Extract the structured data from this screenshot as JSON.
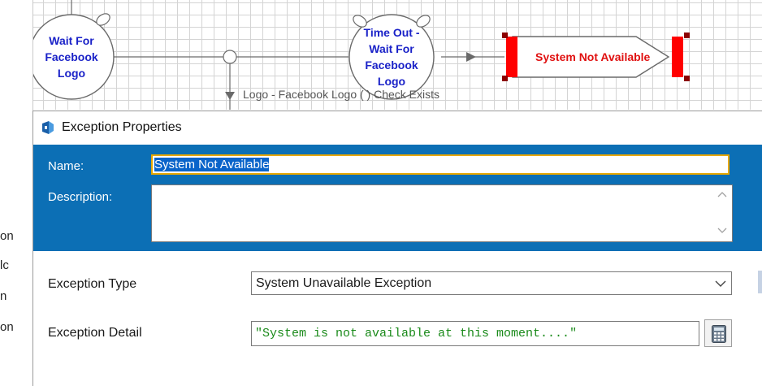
{
  "left_panel": {
    "items": [
      "on",
      "lc",
      "n",
      "on"
    ]
  },
  "flow": {
    "nodes": {
      "wait_node": "Wait For Facebook Logo",
      "timeout_node": "Time Out - Wait For Facebook Logo",
      "exception_node": "System Not Available"
    },
    "link_label": "Logo - Facebook Logo (        ) Check Exists"
  },
  "dialog": {
    "title": "Exception Properties",
    "name_label": "Name:",
    "name_value": "System Not Available",
    "description_label": "Description:",
    "description_value": "",
    "exception_type_label": "Exception Type",
    "exception_type_value": "System Unavailable Exception",
    "exception_detail_label": "Exception Detail",
    "exception_detail_value": "\"System is not available at this moment....\""
  },
  "colors": {
    "header_band": "#0c6fb5",
    "name_focus_border": "#e8a800",
    "selection": "#0a64ca",
    "node_text": "#1a22c8",
    "exception_text": "#e01010",
    "detail_text": "#1a8a1a"
  },
  "icons": [
    "app-icon",
    "calculator-icon",
    "chevron-down-icon",
    "scroll-up-icon",
    "scroll-down-icon"
  ]
}
